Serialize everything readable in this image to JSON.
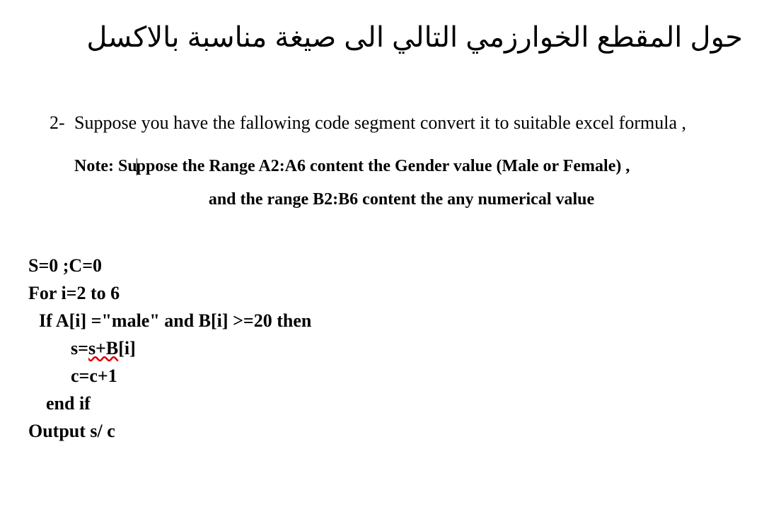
{
  "arabic_title": "حول المقطع الخوارزمي التالي الى صيغة مناسبة بالاكسل",
  "question": {
    "number": "2-",
    "text": "Suppose you have the fallowing code segment convert it to suitable excel formula ,",
    "note_label": "Note: Su",
    "note_mid": "ppose the  Range A2:A6 content the Gender value (Male or Female) ,",
    "note_line2": "and the range B2:B6 content the any numerical value"
  },
  "code": {
    "line1": "S=0  ;C=0",
    "line2": "For i=2 to 6",
    "line3": "If A[i] =\"male\" and B[i] >=20 then",
    "line4_a": "s=",
    "line4_b": "s+B",
    "line4_c": "[i]",
    "line5": "c=c+1",
    "line6": "end if",
    "line7": "Output  s/ c"
  }
}
